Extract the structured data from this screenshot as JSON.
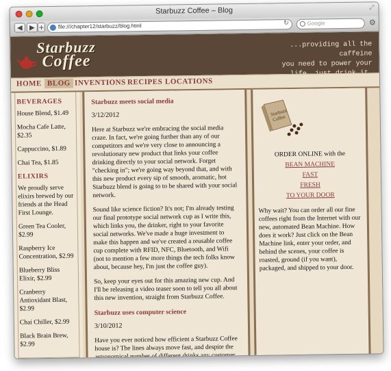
{
  "window": {
    "title": "Starbuzz Coffee – Blog"
  },
  "toolbar": {
    "back": "◀",
    "forward": "▶",
    "new_tab": "+",
    "url": "file:///chapter12/starbuzz/blog.html",
    "search_placeholder": "Google"
  },
  "header": {
    "logo_line1": "Starbuzz",
    "logo_line2": "Coffee",
    "tagline": [
      "...providing all the caffeine",
      "you need to power your",
      "life. just drink it."
    ]
  },
  "nav": [
    "HOME",
    "BLOG",
    "INVENTIONS",
    "RECIPES",
    "LOCATIONS"
  ],
  "nav_active": "BLOG",
  "sidebar": {
    "beverages_heading": "BEVERAGES",
    "beverages": [
      "House Blend, $1.49",
      "Mocha Cafe Latte, $2.35",
      "Cappuccino, $1.89",
      "Chai Tea, $1.85"
    ],
    "elixirs_heading": "ELIXIRS",
    "elixirs_intro": "We proudly serve elixirs brewed by our friends at the Head First Lounge.",
    "elixirs": [
      "Green Tea Cooler, $2.99",
      "Raspberry Ice Concentration, $2.99",
      "Blueberry Bliss Elixir, $2.99",
      "Cranberry Antioxidant Blast, $2.99",
      "Chai Chiller, $2.99",
      "Black Brain Brew, $2.99"
    ]
  },
  "posts": [
    {
      "title": "Starbuzz meets social media",
      "date": "3/12/2012",
      "paragraphs": [
        "Here at Starbuzz we're embracing the social media craze. In fact, we're going further than any of our competitors and we're very close to announcing a revolutionary new product that links your coffee drinking directly to your social network. Forget \"checking in\"; we're going way beyond that, and with this new product every sip of smooth, aromatic, hot Starbuzz blend is going to to be shared with your social network.",
        "Sound like science fiction? It's not; I'm already testing our final prototype social network cup as I write this, which links you, the drinker, right to your favorite social networks. We've made a huge investment to make this happen and we've created a reusable coffee cup complete with RFID, NFC, Bluetooth, and Wifi (not to mention a few more things the tech folks know about, because hey, I'm just the coffee guy).",
        "So, keep your eyes out for this amazing new cup. And I'll be releasing a video teaser soon to tell you all about this new invention, straight from Starbuzz Coffee."
      ]
    },
    {
      "title": "Starbuzz uses computer science",
      "date": "3/10/2012",
      "paragraphs": [
        "Have you ever noticed how efficient a Starbuzz Coffee house is? The lines always move fast, and despite the astronomical number of different drinks any customer can order, we have your drink up, hot (or cold if that's the way you want it) and ready in seconds. How do we"
      ]
    }
  ],
  "aside": {
    "order_prefix": "ORDER ONLINE with the",
    "order_lines": [
      "BEAN MACHINE",
      "FAST",
      "FRESH",
      "TO YOUR DOOR"
    ],
    "why_text": "Why wait? You can order all our fine coffees right from the Internet with our new, automated Bean Machine. How does it work? Just click on the Bean Machine link, enter your order, and behind the scenes, your coffee is roasted, ground (if you want), packaged, and shipped to your door."
  }
}
